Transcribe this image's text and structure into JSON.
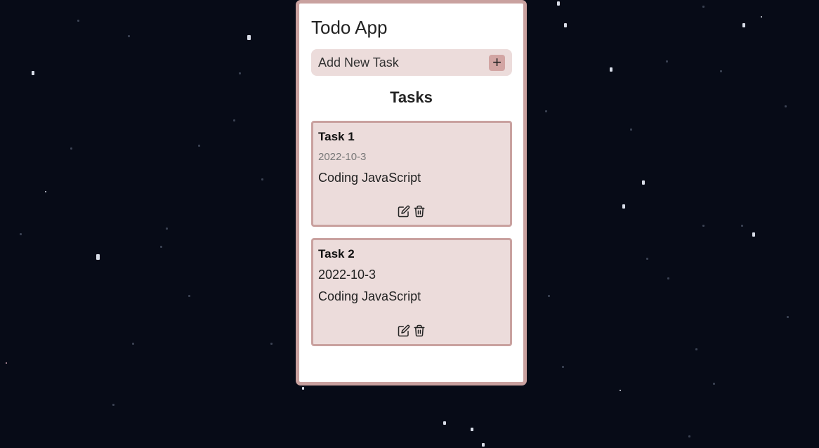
{
  "app": {
    "title": "Todo App"
  },
  "add_task": {
    "label": "Add New Task",
    "button_icon": "plus-icon",
    "button_symbol": "+"
  },
  "tasks_section": {
    "title": "Tasks"
  },
  "tasks": [
    {
      "name": "Task 1",
      "date": "2022-10-3",
      "description": "Coding JavaScript",
      "edit_icon": "edit-icon",
      "delete_icon": "trash-icon"
    },
    {
      "name": "Task 2",
      "date": "2022-10-3",
      "description": "Coding JavaScript",
      "edit_icon": "edit-icon",
      "delete_icon": "trash-icon"
    }
  ],
  "colors": {
    "background": "#070b17",
    "panel_border": "#c9a19f",
    "card_bg": "#ecdcdb",
    "add_button": "#d2a5a3"
  }
}
